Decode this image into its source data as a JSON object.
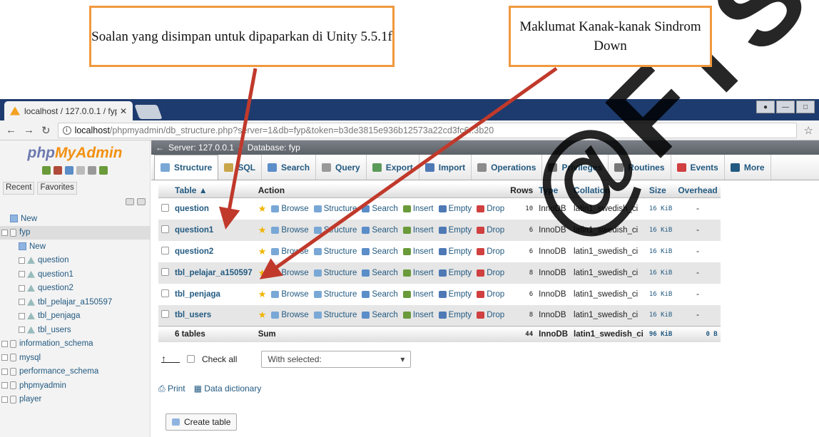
{
  "callouts": {
    "left": "Soalan yang disimpan untuk dipaparkan di Unity 5.5.1f",
    "right": "Maklumat Kanak-kanak Sindrom Down"
  },
  "browser": {
    "tab_title": "localhost / 127.0.0.1 / fyp",
    "url_host": "localhost",
    "url_rest": "/phpmyadmin/db_structure.php?server=1&db=fyp&token=b3de3815e936b12573a22cd3fc6..3b20"
  },
  "sidebar": {
    "logo_php": "php",
    "logo_my": "MyAdmin",
    "recent": "Recent",
    "favorites": "Favorites",
    "tree": [
      {
        "label": "New",
        "kind": "new",
        "indent": 1
      },
      {
        "label": "fyp",
        "kind": "db",
        "indent": 0,
        "selected": true
      },
      {
        "label": "New",
        "kind": "new",
        "indent": 2
      },
      {
        "label": "question",
        "kind": "table",
        "indent": 2
      },
      {
        "label": "question1",
        "kind": "table",
        "indent": 2
      },
      {
        "label": "question2",
        "kind": "table",
        "indent": 2
      },
      {
        "label": "tbl_pelajar_a150597",
        "kind": "table",
        "indent": 2
      },
      {
        "label": "tbl_penjaga",
        "kind": "table",
        "indent": 2
      },
      {
        "label": "tbl_users",
        "kind": "table",
        "indent": 2
      },
      {
        "label": "information_schema",
        "kind": "db",
        "indent": 0
      },
      {
        "label": "mysql",
        "kind": "db",
        "indent": 0
      },
      {
        "label": "performance_schema",
        "kind": "db",
        "indent": 0
      },
      {
        "label": "phpmyadmin",
        "kind": "db",
        "indent": 0
      },
      {
        "label": "player",
        "kind": "db",
        "indent": 0
      }
    ]
  },
  "breadcrumb": {
    "server": "Server: 127.0.0.1",
    "sep": "»",
    "database": "Database: fyp"
  },
  "menu": [
    {
      "label": "Structure",
      "color": "#7aa8d6",
      "active": true
    },
    {
      "label": "SQL",
      "color": "#c9a64a"
    },
    {
      "label": "Search",
      "color": "#5b8dc8"
    },
    {
      "label": "Query",
      "color": "#999999"
    },
    {
      "label": "Export",
      "color": "#5a9a5a"
    },
    {
      "label": "Import",
      "color": "#4e79b5"
    },
    {
      "label": "Operations",
      "color": "#8c8c8c"
    },
    {
      "label": "Privileges",
      "color": "#7a7a7a"
    },
    {
      "label": "Routines",
      "color": "#777777"
    },
    {
      "label": "Events",
      "color": "#d04040"
    },
    {
      "label": "More",
      "color": "#235a81"
    }
  ],
  "table": {
    "headers": {
      "table": "Table",
      "action": "Action",
      "rows": "Rows",
      "type": "Type",
      "collation": "Collation",
      "size": "Size",
      "overhead": "Overhead"
    },
    "actions": [
      {
        "label": "Browse",
        "color": "#7aa8d6"
      },
      {
        "label": "Structure",
        "color": "#7aa8d6"
      },
      {
        "label": "Search",
        "color": "#5b8dc8"
      },
      {
        "label": "Insert",
        "color": "#6a9a3a"
      },
      {
        "label": "Empty",
        "color": "#4e79b5"
      },
      {
        "label": "Drop",
        "color": "#d04040"
      }
    ],
    "rows": [
      {
        "name": "question",
        "rows": "10",
        "type": "InnoDB",
        "collation": "latin1_swedish_ci",
        "size": "16 KiB",
        "overhead": "-"
      },
      {
        "name": "question1",
        "rows": "6",
        "type": "InnoDB",
        "collation": "latin1_swedish_ci",
        "size": "16 KiB",
        "overhead": "-"
      },
      {
        "name": "question2",
        "rows": "6",
        "type": "InnoDB",
        "collation": "latin1_swedish_ci",
        "size": "16 KiB",
        "overhead": "-"
      },
      {
        "name": "tbl_pelajar_a150597",
        "rows": "8",
        "type": "InnoDB",
        "collation": "latin1_swedish_ci",
        "size": "16 KiB",
        "overhead": "-"
      },
      {
        "name": "tbl_penjaga",
        "rows": "6",
        "type": "InnoDB",
        "collation": "latin1_swedish_ci",
        "size": "16 KiB",
        "overhead": "-"
      },
      {
        "name": "tbl_users",
        "rows": "8",
        "type": "InnoDB",
        "collation": "latin1_swedish_ci",
        "size": "16 KiB",
        "overhead": "-"
      }
    ],
    "footer": {
      "count": "6 tables",
      "sum": "Sum",
      "rows": "44",
      "type": "InnoDB",
      "collation": "latin1_swedish_ci",
      "size": "96 KiB",
      "overhead": "0 B"
    }
  },
  "bulk": {
    "check_all": "Check all",
    "with_selected": "With selected:"
  },
  "bottom": {
    "print": "Print",
    "dictionary": "Data dictionary",
    "create_table": "Create table"
  },
  "watermark": "@FTSM"
}
